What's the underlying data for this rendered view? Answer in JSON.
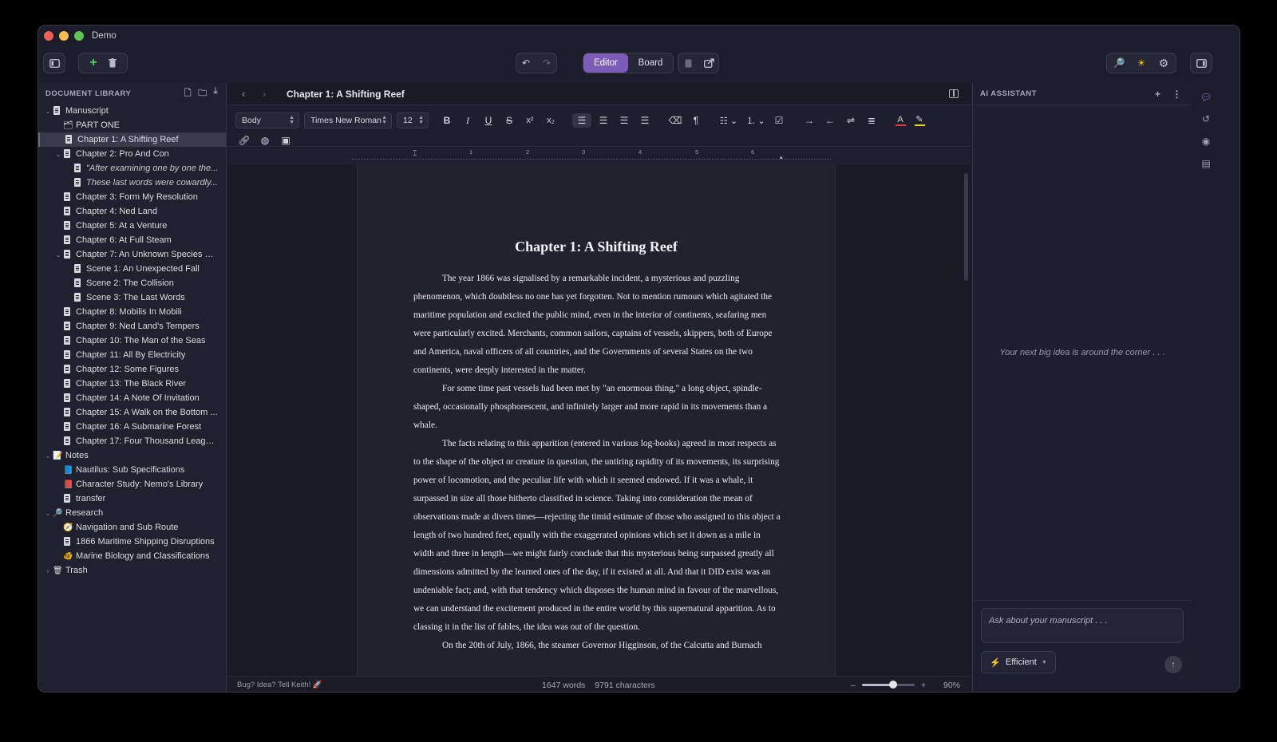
{
  "window": {
    "title": "Demo"
  },
  "toolbar": {
    "view_editor": "Editor",
    "view_board": "Board"
  },
  "sidebar": {
    "header": "DOCUMENT LIBRARY",
    "items": [
      {
        "label": "Manuscript",
        "level": 0,
        "chev": "v",
        "icon": "doc"
      },
      {
        "label": "PART ONE",
        "level": 1,
        "chev": "",
        "icon": "folder-icon"
      },
      {
        "label": "Chapter 1: A Shifting Reef",
        "level": 1,
        "chev": "",
        "icon": "doc",
        "selected": true
      },
      {
        "label": "Chapter 2: Pro And Con",
        "level": 1,
        "chev": "v",
        "icon": "doc"
      },
      {
        "label": "\"After examining one by one the...",
        "level": 2,
        "chev": "",
        "icon": "doc",
        "italic": true
      },
      {
        "label": "These last words were cowardly...",
        "level": 2,
        "chev": "",
        "icon": "doc",
        "italic": true
      },
      {
        "label": "Chapter 3: Form My Resolution",
        "level": 1,
        "chev": "",
        "icon": "doc"
      },
      {
        "label": "Chapter 4: Ned Land",
        "level": 1,
        "chev": "",
        "icon": "doc"
      },
      {
        "label": "Chapter 5: At a Venture",
        "level": 1,
        "chev": "",
        "icon": "doc"
      },
      {
        "label": "Chapter 6: At Full Steam",
        "level": 1,
        "chev": "",
        "icon": "doc"
      },
      {
        "label": "Chapter 7: An Unknown Species of...",
        "level": 1,
        "chev": "v",
        "icon": "doc"
      },
      {
        "label": "Scene 1: An Unexpected Fall",
        "level": 2,
        "chev": "",
        "icon": "doc"
      },
      {
        "label": "Scene 2: The Collision",
        "level": 2,
        "chev": "",
        "icon": "doc"
      },
      {
        "label": "Scene 3: The Last Words",
        "level": 2,
        "chev": "",
        "icon": "doc"
      },
      {
        "label": "Chapter 8: Mobilis In Mobili",
        "level": 1,
        "chev": "",
        "icon": "doc"
      },
      {
        "label": "Chapter 9: Ned Land's Tempers",
        "level": 1,
        "chev": "",
        "icon": "doc"
      },
      {
        "label": "Chapter 10: The Man of the Seas",
        "level": 1,
        "chev": "",
        "icon": "doc"
      },
      {
        "label": "Chapter 11: All By Electricity",
        "level": 1,
        "chev": "",
        "icon": "doc"
      },
      {
        "label": "Chapter 12: Some Figures",
        "level": 1,
        "chev": "",
        "icon": "doc"
      },
      {
        "label": "Chapter 13: The Black River",
        "level": 1,
        "chev": "",
        "icon": "doc"
      },
      {
        "label": "Chapter 14: A Note Of Invitation",
        "level": 1,
        "chev": "",
        "icon": "doc"
      },
      {
        "label": "Chapter 15: A Walk on the Bottom ...",
        "level": 1,
        "chev": "",
        "icon": "doc"
      },
      {
        "label": "Chapter 16: A Submarine Forest",
        "level": 1,
        "chev": "",
        "icon": "doc"
      },
      {
        "label": "Chapter 17: Four Thousand League...",
        "level": 1,
        "chev": "",
        "icon": "doc"
      },
      {
        "label": "Notes",
        "level": 0,
        "chev": "v",
        "icon": "notes-icon"
      },
      {
        "label": "Nautilus: Sub Specifications",
        "level": 1,
        "chev": "",
        "icon": "blue-book-icon"
      },
      {
        "label": "Character Study: Nemo's Library",
        "level": 1,
        "chev": "",
        "icon": "red-book-icon"
      },
      {
        "label": "transfer",
        "level": 1,
        "chev": "",
        "icon": "doc"
      },
      {
        "label": "Research",
        "level": 0,
        "chev": "v",
        "icon": "magnifier-icon"
      },
      {
        "label": "Navigation and Sub Route",
        "level": 1,
        "chev": "",
        "icon": "compass-icon"
      },
      {
        "label": "1866 Maritime Shipping Disruptions",
        "level": 1,
        "chev": "",
        "icon": "doc"
      },
      {
        "label": "Marine Biology and Classifications",
        "level": 1,
        "chev": "",
        "icon": "fish-icon"
      },
      {
        "label": "Trash",
        "level": 0,
        "chev": ">",
        "icon": "trash-icon"
      }
    ]
  },
  "editor": {
    "doc_title": "Chapter 1: A Shifting Reef",
    "style_select": "Body",
    "font_select": "Times New Roman",
    "size_select": "12",
    "ruler_numbers": [
      "1",
      "2",
      "3",
      "4",
      "5",
      "6"
    ],
    "page_heading": "Chapter 1: A Shifting Reef",
    "paragraphs": [
      "The year 1866 was signalised by a remarkable incident, a mysterious and puzzling phenomenon, which doubtless no one has yet forgotten. Not to mention rumours which agitated the maritime population and excited the public mind, even in the interior of continents, seafaring men were particularly excited. Merchants, common sailors, captains of vessels, skippers, both of Europe and America, naval officers of all countries, and the Governments of several States on the two continents, were deeply interested in the matter.",
      "For some time past vessels had been met by \"an enormous thing,\" a long object, spindle-shaped, occasionally phosphorescent, and infinitely larger and more rapid in its movements than a whale.",
      "The facts relating to this apparition (entered in various log-books) agreed in most respects as to the shape of the object or creature in question, the untiring rapidity of its movements, its surprising power of locomotion, and the peculiar life with which it seemed endowed. If it was a whale, it surpassed in size all those hitherto classified in science. Taking into consideration the mean of observations made at divers times—rejecting the timid estimate of those who assigned to this object a length of two hundred feet, equally with the exaggerated opinions which set it down as a mile in width and three in length—we might fairly conclude that this mysterious being surpassed greatly all dimensions admitted by the learned ones of the day, if it existed at all. And that it DID exist was an undeniable fact; and, with that tendency which disposes the human mind in favour of the marvellous, we can understand the excitement produced in the entire world by this supernatural apparition. As to classing it in the list of fables, the idea was out of the question.",
      "On the 20th of July, 1866, the steamer Governor Higginson, of the Calcutta and Burnach"
    ]
  },
  "status": {
    "feedback": "Bug? Idea? Tell Keith! 🚀",
    "words": "1647 words",
    "characters": "9791 characters",
    "zoom_minus": "–",
    "zoom_plus": "+",
    "zoom_level": "90%",
    "zoom_fraction": 0.6
  },
  "ai": {
    "header": "AI ASSISTANT",
    "empty_text": "Your next big idea is around the corner . . .",
    "input_placeholder": "Ask about your manuscript . . .",
    "mode_label": "Efficient"
  },
  "colors": {
    "accent": "#7b5cb8",
    "text_color_underline": "#e03a3a",
    "highlight_underline": "#f5d020"
  }
}
